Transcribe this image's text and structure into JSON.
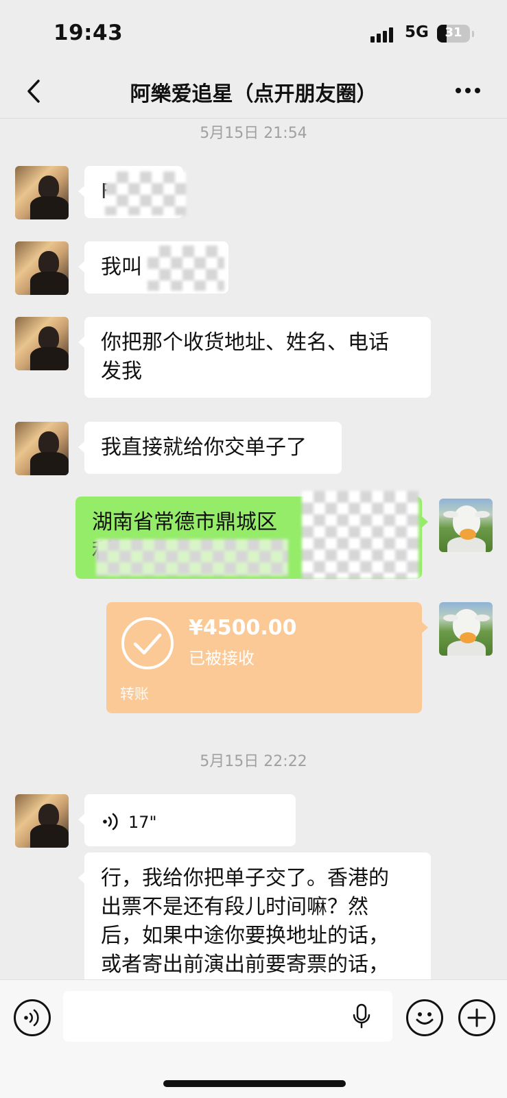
{
  "status_bar": {
    "time": "19:43",
    "network": "5G",
    "battery": "31"
  },
  "header": {
    "title": "阿樂爱追星（点开朋友圈）"
  },
  "messages": {
    "ts1": "5月15日 21:54",
    "m1": "F",
    "m2": "我叫",
    "m3_line1": "你把那个收货地址、姓名、电话",
    "m3_line2": "发我",
    "m4": "我直接就给你交单子了",
    "m5_line1": "湖南省常德市鼎城区",
    "m5_line2": "利",
    "transfer": {
      "amount": "¥4500.00",
      "status": "已被接收",
      "label": "转账"
    },
    "ts2": "5月15日 22:22",
    "voice_duration": "17\"",
    "m7_line1": "行，我给你把单子交了。香港的",
    "m7_line2": "出票不是还有段儿时间嘛？然",
    "m7_line3": "后，如果中途你要换地址的话，",
    "m7_line4": "或者寄出前演出前要寄票的话，"
  },
  "icons": {
    "back": "chevron-left-icon",
    "more": "more-dots-icon",
    "voice_toggle": "voice-icon",
    "mic": "microphone-icon",
    "emoji": "emoji-icon",
    "plus": "plus-icon"
  },
  "colors": {
    "background": "#ededed",
    "sent_bubble": "#95ec69",
    "received_bubble": "#ffffff",
    "transfer_card": "#fbc996"
  }
}
